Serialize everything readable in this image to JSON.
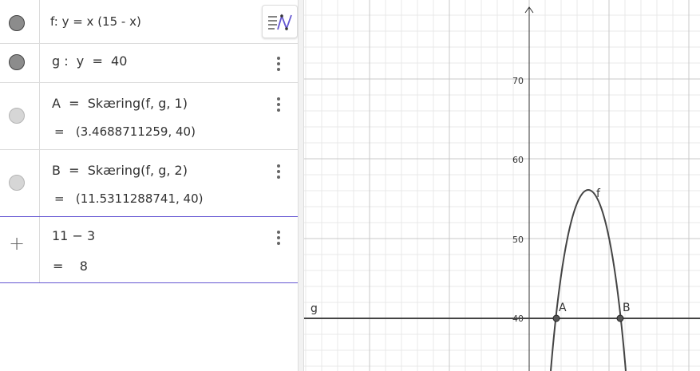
{
  "algebra": {
    "rows": [
      {
        "name": "f",
        "definition": "f: y = x (15 - x)",
        "value": "",
        "visible": true
      },
      {
        "name": "g",
        "definition": "g :  y  =  40",
        "value": "",
        "visible": true
      },
      {
        "name": "A",
        "definition": "A  =  Skæring(f, g, 1)",
        "value": "=   (3.4688711259, 40)",
        "visible": false
      },
      {
        "name": "B",
        "definition": "B  =  Skæring(f, g, 2)",
        "value": "=   (11.5311288741, 40)",
        "visible": false
      },
      {
        "name": "input",
        "definition": "11 − 3",
        "value": "=    8",
        "visible": false
      }
    ]
  },
  "graphics": {
    "y_ticks": [
      "70",
      "60",
      "50",
      "40"
    ],
    "labels": {
      "f": "f",
      "g": "g",
      "A": "A",
      "B": "B"
    },
    "colors": {
      "axis": "#333333",
      "grid_minor": "#e8e8e8",
      "grid_major": "#c8c8c8",
      "curve": "#444444"
    }
  }
}
